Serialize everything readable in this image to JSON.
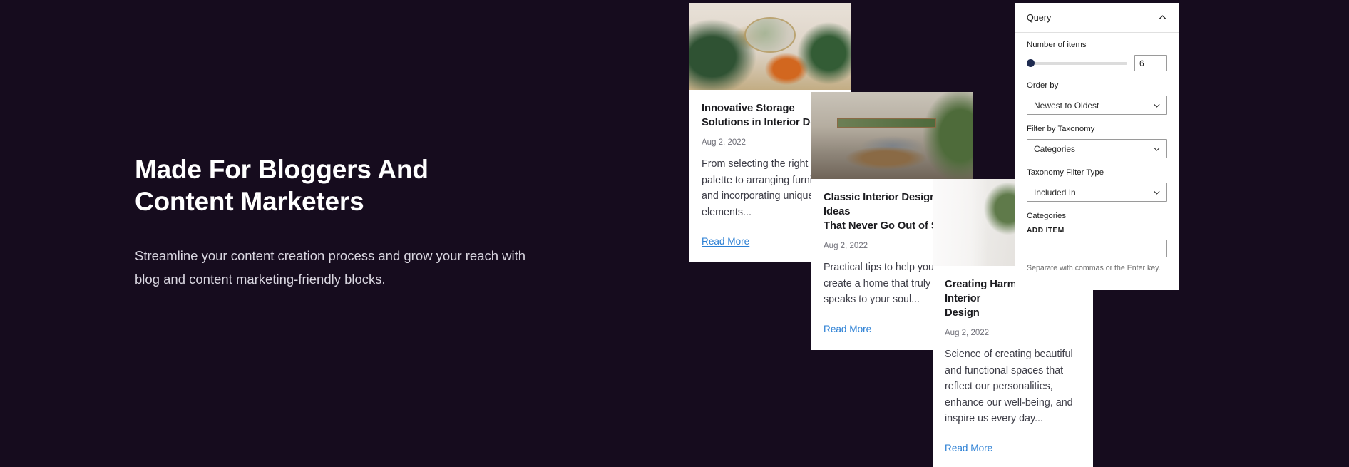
{
  "theme": {
    "background": "#160c1e",
    "heading_color": "#ffffff",
    "body_color": "#d9d6e0",
    "link_color": "#2b7fd4",
    "panel_background": "#ffffff",
    "slider_thumb_color": "#1e2b50"
  },
  "hero": {
    "title": "Made For Bloggers And\nContent Marketers",
    "subtitle": "Streamline your content creation process and grow your reach with\nblog and content marketing-friendly blocks."
  },
  "cards": [
    {
      "title": "Innovative Storage\nSolutions in Interior Design",
      "date": "Aug 2, 2022",
      "excerpt": "From selecting the right color\npalette to arranging furniture\nand incorporating unique\nelements...",
      "link_label": "Read More",
      "image_alt": "interior-room-with-plants-and-orange-armchair"
    },
    {
      "title": "Classic Interior Design Ideas\nThat Never Go Out of Style",
      "date": "Aug 2, 2022",
      "excerpt": "Practical tips to help you\ncreate a home that truly\nspeaks to your soul...",
      "link_label": "Read More",
      "image_alt": "modern-living-room-with-grey-sofas-and-large-windows"
    },
    {
      "title": "Creating Harmony in Interior\nDesign",
      "date": "Aug 2, 2022",
      "excerpt": "Science of creating beautiful\nand functional spaces that\nreflect our personalities,\nenhance our well-being, and\ninspire us every day...",
      "link_label": "Read More",
      "image_alt": "white-room-with-plant-on-table-and-sheer-curtain"
    }
  ],
  "panel": {
    "title": "Query",
    "collapse_icon": "chevron-up-icon",
    "number_of_items": {
      "label": "Number of items",
      "value": "6",
      "slider_position_percent": 0
    },
    "order_by": {
      "label": "Order by",
      "value": "Newest to Oldest"
    },
    "filter_by_taxonomy": {
      "label": "Filter by Taxonomy",
      "value": "Categories"
    },
    "taxonomy_filter_type": {
      "label": "Taxonomy Filter Type",
      "value": "Included In"
    },
    "categories": {
      "label": "Categories",
      "add_item_label": "ADD ITEM",
      "input_value": "",
      "input_placeholder": "",
      "help_text": "Separate with commas or the Enter key."
    }
  }
}
